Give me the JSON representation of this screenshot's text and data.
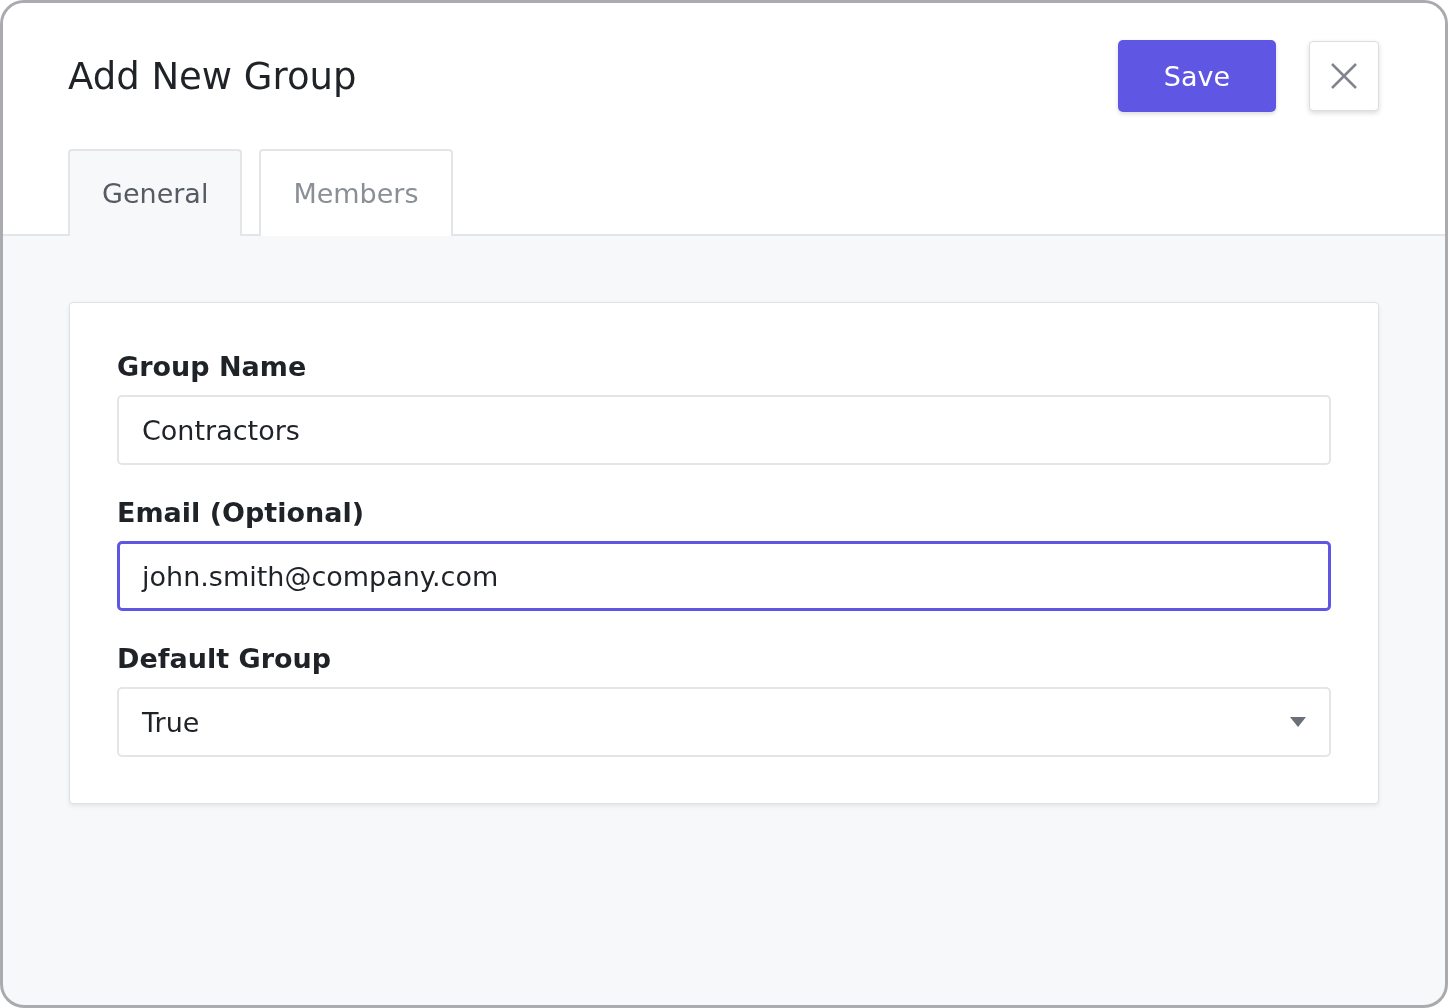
{
  "dialog": {
    "title": "Add New Group",
    "save_button": "Save"
  },
  "tabs": [
    {
      "label": "General",
      "selected": true
    },
    {
      "label": "Members",
      "selected": false
    }
  ],
  "fields": [
    {
      "kind": "text",
      "label": "Group Name",
      "value": "Contractors",
      "focused": false
    },
    {
      "kind": "text",
      "label": "Email (Optional)",
      "value": "john.smith@company.com",
      "focused": true
    },
    {
      "kind": "select",
      "label": "Default Group",
      "value": "True",
      "focused": false
    }
  ]
}
